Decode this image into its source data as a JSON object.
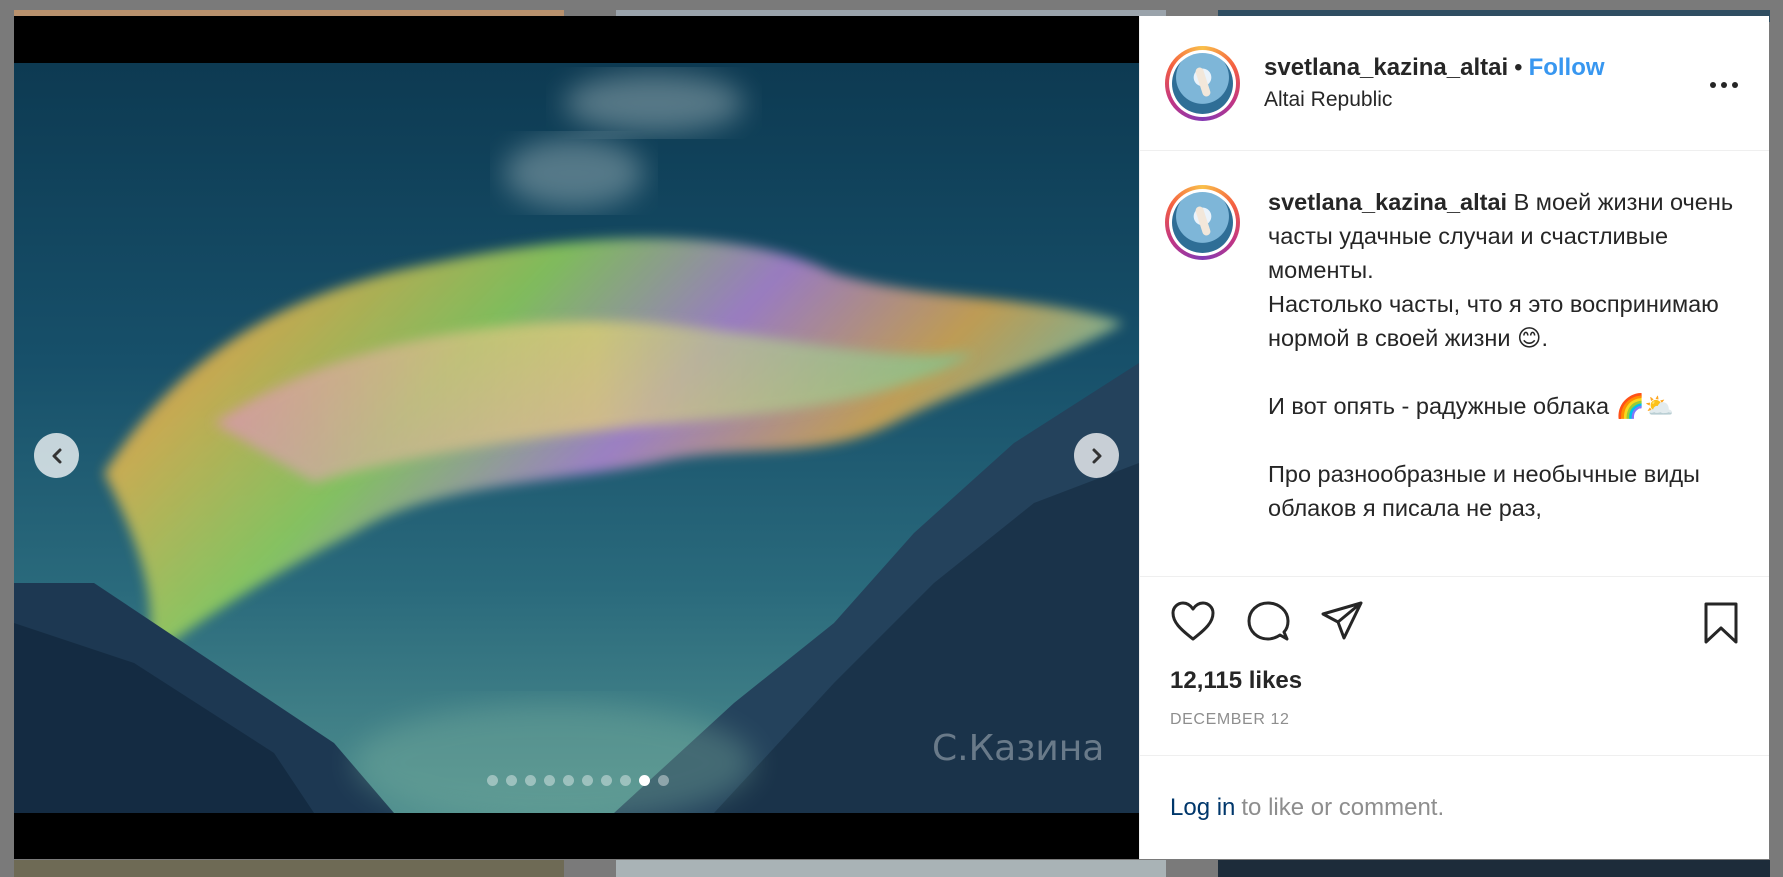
{
  "post": {
    "username": "svetlana_kazina_altai",
    "separator": "•",
    "follow_label": "Follow",
    "location": "Altai Republic",
    "watermark": "С.Казина",
    "slide_count": 10,
    "active_slide": 9
  },
  "caption": {
    "username": "svetlana_kazina_altai",
    "line1": " В моей жизни очень часты удачные случаи и счастливые моменты.",
    "line2": "Настолько часты, что я это воспринимаю нормой в своей жизни 😊.",
    "line3": "И вот опять - радужные облака 🌈⛅",
    "line4": "Про разнообразные и необычные виды облаков я писала не раз,"
  },
  "stats": {
    "likes": "12,115 likes",
    "date": "DECEMBER 12"
  },
  "login": {
    "link": "Log in",
    "text": "to like or comment."
  },
  "icons": {
    "like": "heart-icon",
    "comment": "comment-icon",
    "share": "paper-plane-icon",
    "save": "bookmark-icon",
    "more": "more-dots-icon",
    "prev": "chevron-left-icon",
    "next": "chevron-right-icon"
  },
  "colors": {
    "follow": "#3897f0",
    "link": "#00376b",
    "muted": "#8e8e8e"
  }
}
